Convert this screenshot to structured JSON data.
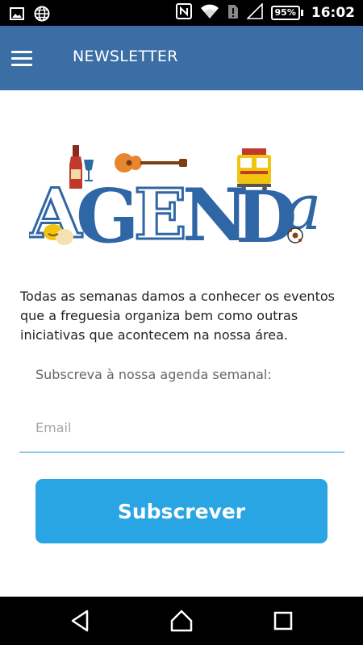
{
  "status_bar": {
    "time": "16:02",
    "battery": "95%",
    "left_icons": [
      "image-icon",
      "globe-icon"
    ],
    "right_icons": [
      "nfc-icon",
      "wifi-icon",
      "sim-alert-icon",
      "signal-icon",
      "battery-icon"
    ]
  },
  "app_bar": {
    "title": "NEWSLETTER",
    "color": "#3b6ea5"
  },
  "logo": {
    "text": "AGENDa"
  },
  "content": {
    "intro": "Todas as semanas damos a conhecer os eventos que a freguesia organiza bem como outras iniciativas que acontecem na nossa área.",
    "subscribe_label": "Subscreva à nossa agenda semanal:",
    "email_placeholder": "Email",
    "email_value": "",
    "subscribe_button": "Subscrever",
    "button_color": "#29a5e3"
  },
  "nav_bar": {
    "icons": [
      "back-icon",
      "home-icon",
      "recents-icon"
    ]
  }
}
